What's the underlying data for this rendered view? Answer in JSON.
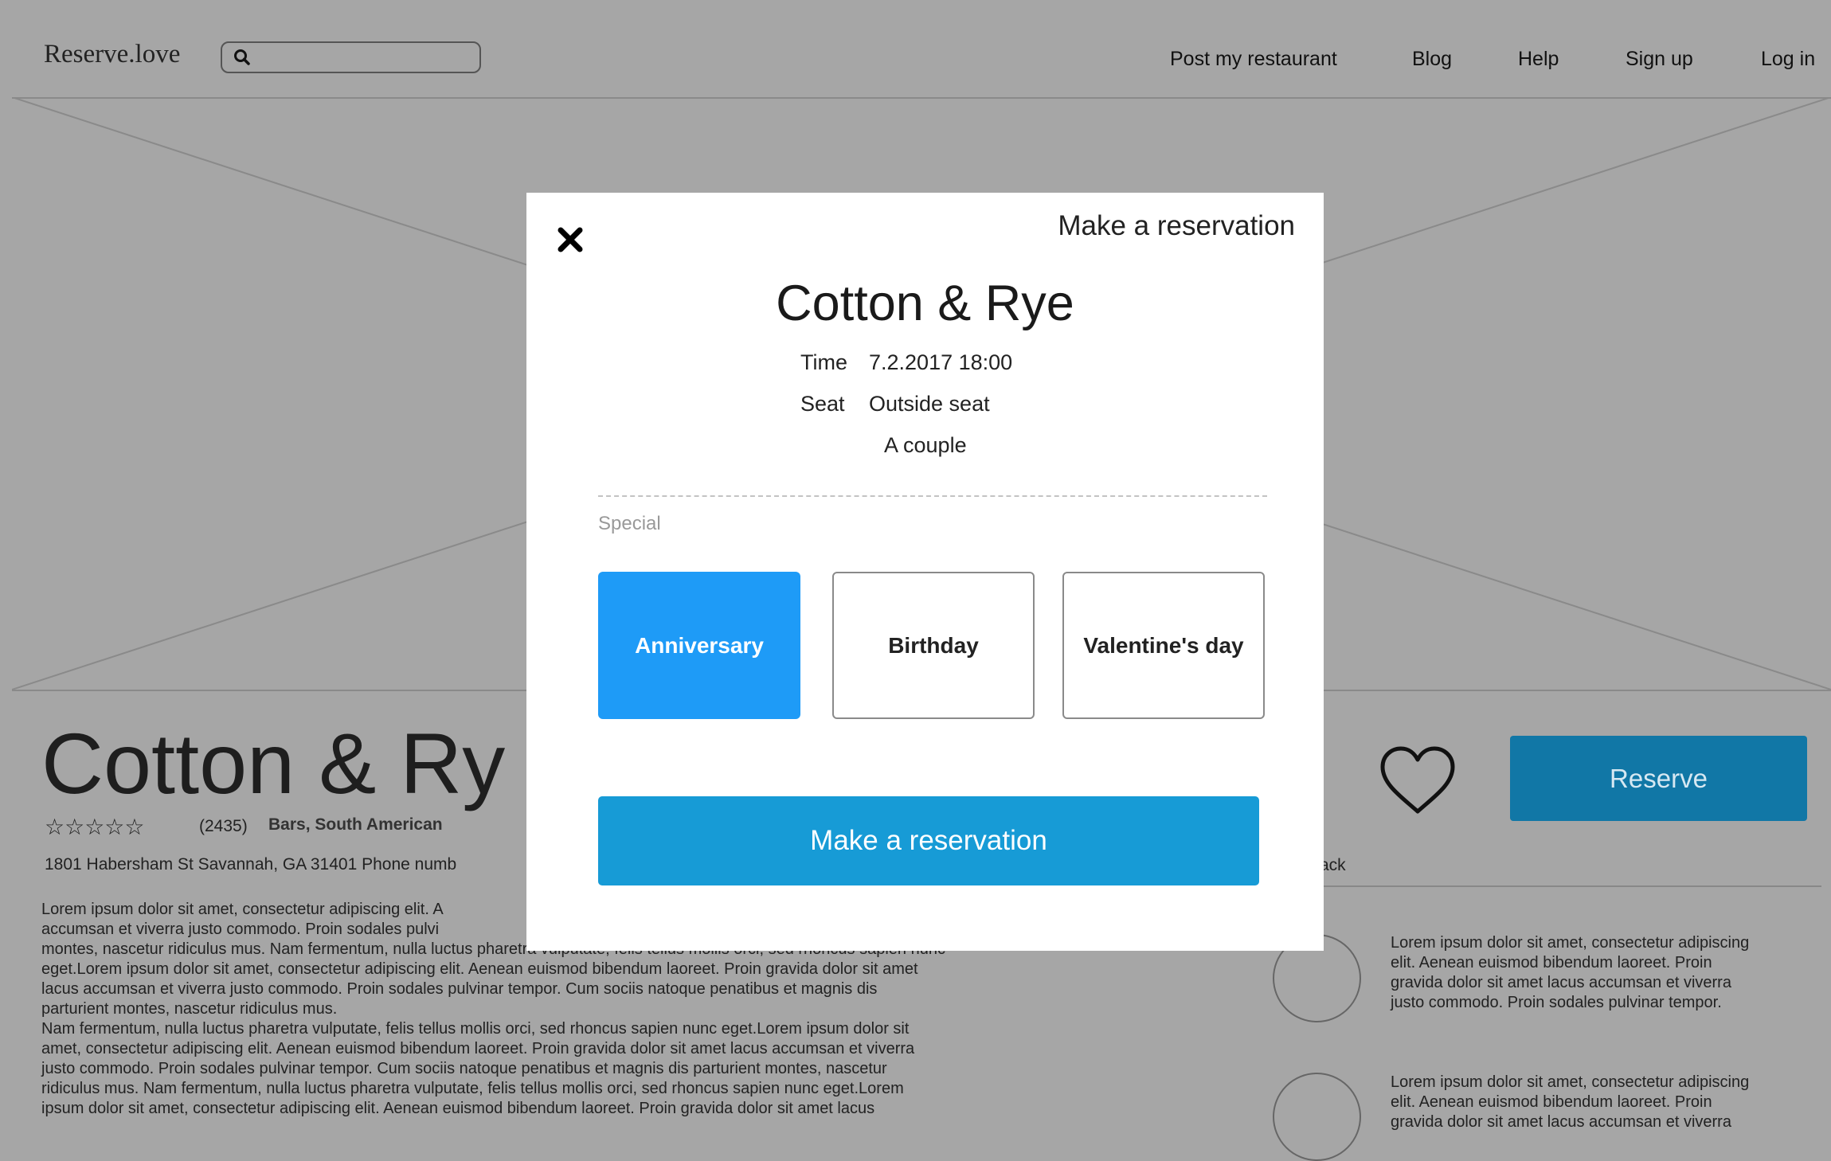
{
  "nav": {
    "logo": "Reserve.love",
    "search_placeholder": "",
    "links": [
      "Post my restaurant",
      "Blog",
      "Help",
      "Sign up",
      "Log in"
    ]
  },
  "restaurant": {
    "title": "Cotton & Ry",
    "stars": "☆☆☆☆☆",
    "review_count": "(2435)",
    "categories": "Bars,  South American",
    "address": "1801 Habersham St Savannah, GA 31401  Phone numb",
    "description": [
      "Lorem ipsum dolor sit amet, consectetur adipiscing elit. A",
      "accumsan et viverra justo commodo. Proin sodales pulvi",
      "montes, nascetur ridiculus mus. Nam fermentum, nulla luctus pharetra vulputate, felis tellus mollis orci, sed rhoncus sapien nunc",
      "eget.Lorem ipsum dolor sit amet, consectetur adipiscing elit. Aenean euismod bibendum laoreet. Proin gravida dolor sit amet",
      "lacus accumsan et viverra justo commodo. Proin sodales pulvinar tempor. Cum sociis natoque penatibus et magnis dis",
      "parturient montes, nascetur ridiculus mus.",
      " Nam fermentum, nulla luctus pharetra vulputate, felis tellus mollis orci, sed rhoncus sapien nunc eget.Lorem ipsum dolor sit",
      "amet, consectetur adipiscing elit. Aenean euismod bibendum laoreet. Proin gravida dolor sit amet lacus accumsan et viverra",
      "justo commodo. Proin sodales pulvinar tempor. Cum sociis natoque penatibus et magnis dis parturient montes, nascetur",
      "ridiculus mus. Nam fermentum, nulla luctus pharetra vulputate, felis tellus mollis orci, sed rhoncus sapien nunc eget.Lorem",
      "ipsum dolor sit amet, consectetur adipiscing elit. Aenean euismod bibendum laoreet. Proin gravida dolor sit amet lacus"
    ],
    "reserve_label": "Reserve",
    "feedback_label": "ack",
    "reviews": [
      [
        "Lorem ipsum dolor sit amet, consectetur adipiscing",
        "elit. Aenean euismod bibendum laoreet. Proin",
        "gravida dolor sit amet lacus accumsan et viverra",
        "justo commodo. Proin sodales pulvinar tempor."
      ],
      [
        "Lorem ipsum dolor sit amet, consectetur adipiscing",
        "elit. Aenean euismod bibendum laoreet. Proin",
        "gravida dolor sit amet lacus accumsan et viverra"
      ]
    ]
  },
  "modal": {
    "header": "Make a reservation",
    "title": "Cotton & Rye",
    "time_label": "Time",
    "time_value": "7.2.2017 18:00",
    "seat_label": "Seat",
    "seat_value": "Outside seat",
    "party": "A couple",
    "special_label": "Special",
    "options": [
      {
        "label": "Anniversary",
        "selected": true
      },
      {
        "label": "Birthday",
        "selected": false
      },
      {
        "label": "Valentine's day",
        "selected": false
      }
    ],
    "submit_label": "Make a reservation"
  },
  "colors": {
    "overlay_bg": "#a6a6a6",
    "selected_option": "#1e9bf7",
    "submit_button": "#179bd6",
    "reserve_button": "#1177a6"
  }
}
